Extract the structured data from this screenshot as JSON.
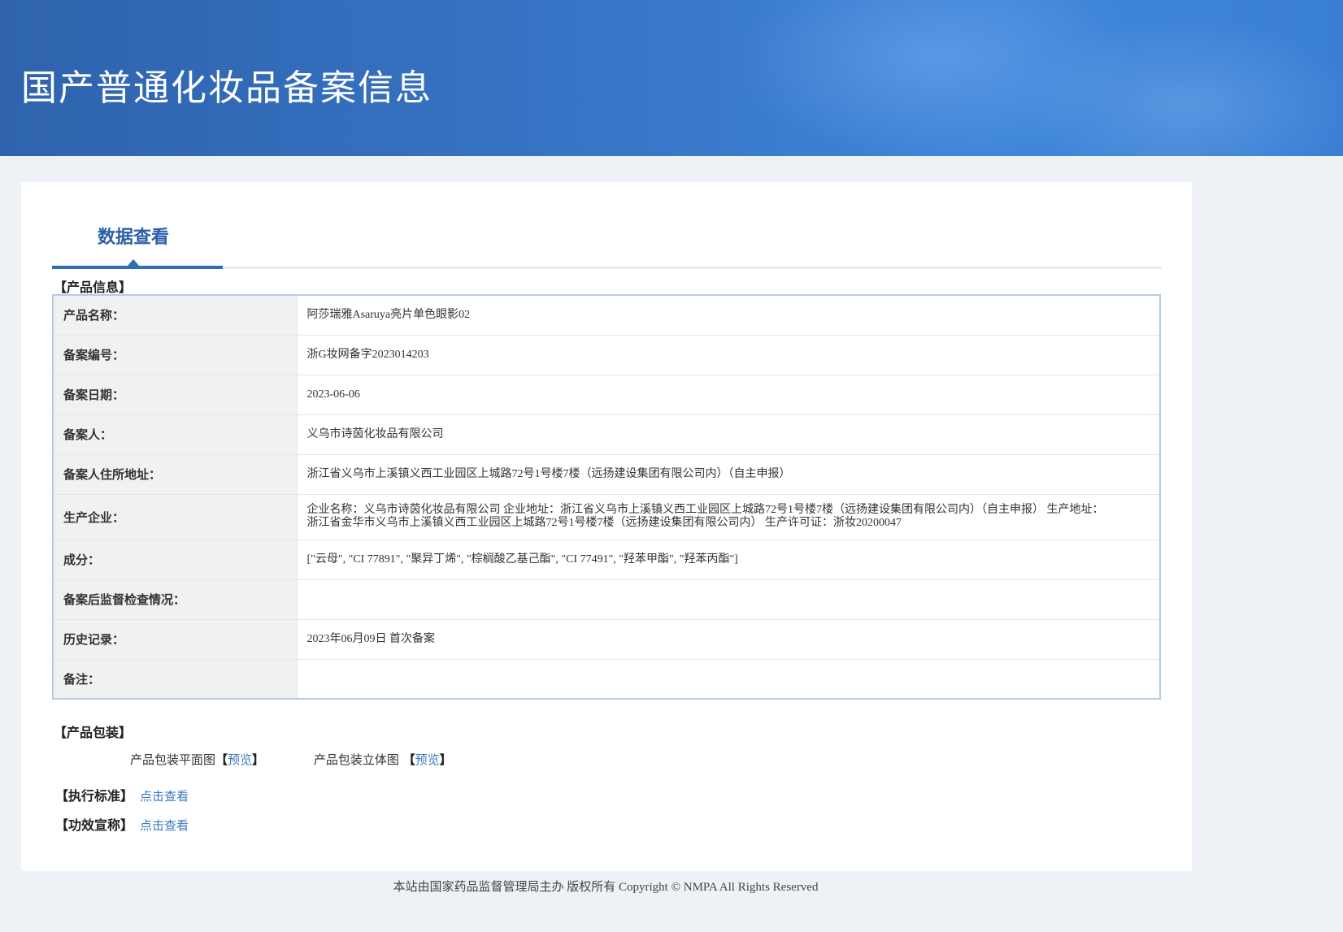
{
  "header": {
    "title": "国产普通化妆品备案信息"
  },
  "tab": {
    "label": "数据查看"
  },
  "product_info": {
    "section_title": "【产品信息】",
    "rows": [
      {
        "label": "产品名称：",
        "value": "阿莎瑞雅Asaruya亮片单色眼影02"
      },
      {
        "label": "备案编号：",
        "value": "浙G妆网备字2023014203"
      },
      {
        "label": "备案日期：",
        "value": "2023-06-06"
      },
      {
        "label": "备案人：",
        "value": "义乌市诗茵化妆品有限公司"
      },
      {
        "label": "备案人住所地址：",
        "value": "浙江省义乌市上溪镇义西工业园区上城路72号1号楼7楼（远扬建设集团有限公司内）（自主申报）"
      },
      {
        "label": "生产企业：",
        "value": "企业名称：义乌市诗茵化妆品有限公司 企业地址：浙江省义乌市上溪镇义西工业园区上城路72号1号楼7楼（远扬建设集团有限公司内）（自主申报） 生产地址：浙江省金华市义乌市上溪镇义西工业园区上城路72号1号楼7楼（远扬建设集团有限公司内） 生产许可证：浙妆20200047"
      },
      {
        "label": "成分：",
        "value": "[\"云母\", \"CI 77891\", \"聚异丁烯\", \"棕榈酸乙基己酯\", \"CI 77491\", \"羟苯甲酯\", \"羟苯丙酯\"]"
      },
      {
        "label": "备案后监督检查情况：",
        "value": ""
      },
      {
        "label": "历史记录：",
        "value": "2023年06月09日 首次备案"
      },
      {
        "label": "备注：",
        "value": ""
      }
    ]
  },
  "packaging": {
    "section_title": "【产品包装】",
    "flat_label": "产品包装平面图",
    "flat_open": "【",
    "flat_link": "预览",
    "flat_close": "】",
    "3d_label": "产品包装立体图",
    "3d_open": "【",
    "3d_link": "预览",
    "3d_close": "】"
  },
  "standard": {
    "section_title": "【执行标准】",
    "link": "点击查看"
  },
  "efficacy": {
    "section_title": "【功效宣称】",
    "link": "点击查看"
  },
  "footer": {
    "text": "本站由国家药品监督管理局主办 版权所有 Copyright © NMPA All Rights Reserved"
  }
}
